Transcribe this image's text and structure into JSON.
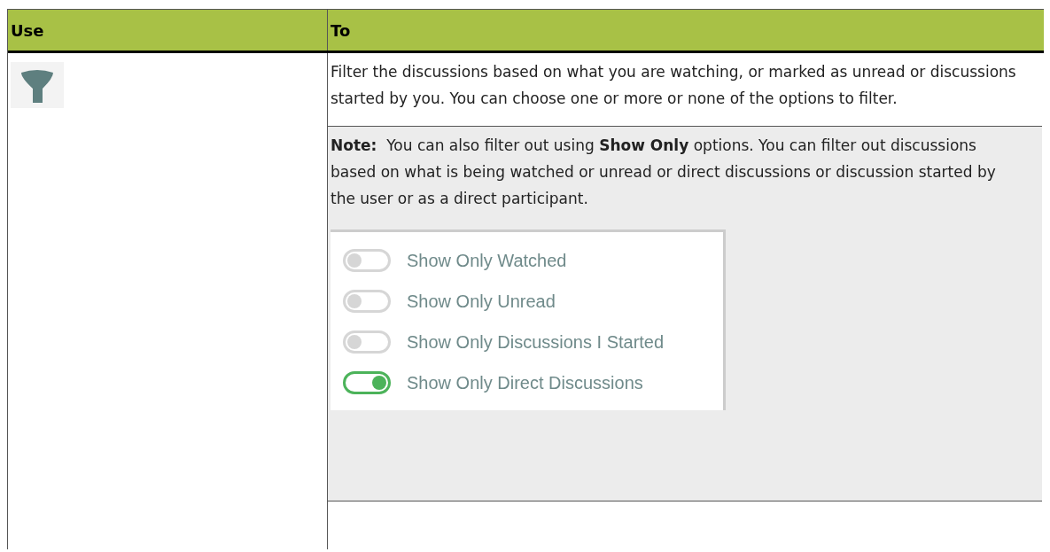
{
  "table": {
    "columns": [
      "Use",
      "To"
    ],
    "rows": [
      {
        "description": "Filter the discussions based on what you are watching, or marked as unread or discussions started by you. You can choose one or more or none of the options to filter.",
        "note": {
          "label": "Note:",
          "text": "You can also filter out using **Show Only** options. You can filter out discussions based on what is being watched or unread or direct discussions or discussion started by the user or as a direct participant.",
          "toggles": [
            {
              "label": "Show Only Watched",
              "on": false
            },
            {
              "label": "Show Only Unread",
              "on": false
            },
            {
              "label": "Show Only Discussions I Started",
              "on": false
            },
            {
              "label": "Show Only Direct Discussions",
              "on": true
            }
          ]
        }
      }
    ]
  }
}
